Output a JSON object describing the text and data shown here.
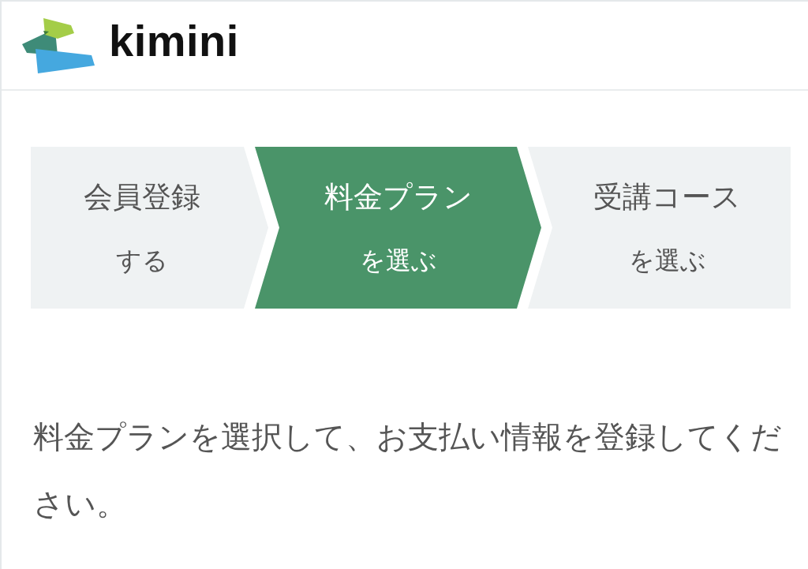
{
  "header": {
    "logo_text": "kimini"
  },
  "steps": [
    {
      "title": "会員登録",
      "subtitle": "する",
      "selected": false
    },
    {
      "title": "料金プラン",
      "subtitle": "を選ぶ",
      "selected": true
    },
    {
      "title": "受講コース",
      "subtitle": "を選ぶ",
      "selected": false
    }
  ],
  "instruction": "料金プランを選択して、お支払い情報を登録してください。"
}
